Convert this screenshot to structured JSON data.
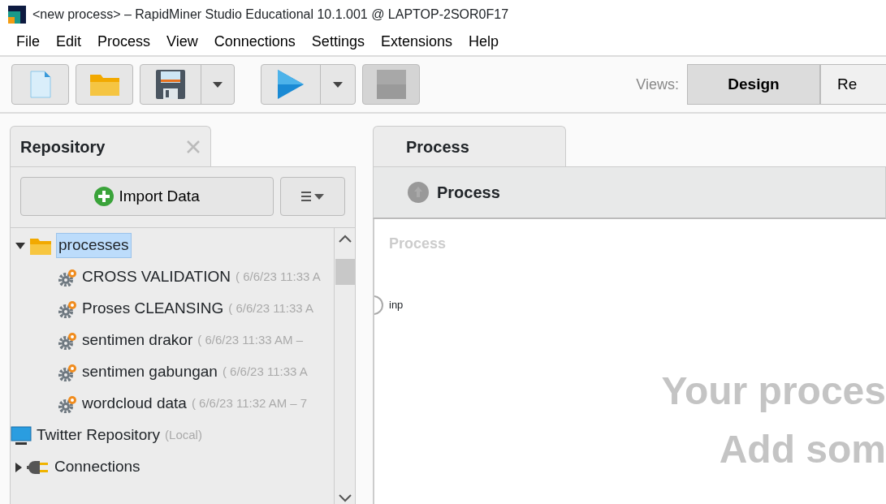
{
  "window": {
    "title": "<new process> – RapidMiner Studio Educational 10.1.001 @ LAPTOP-2SOR0F17"
  },
  "menu": [
    "File",
    "Edit",
    "Process",
    "View",
    "Connections",
    "Settings",
    "Extensions",
    "Help"
  ],
  "toolbar": {
    "views_label": "Views:",
    "views": [
      {
        "label": "Design",
        "selected": true
      },
      {
        "label": "Re",
        "selected": false
      }
    ]
  },
  "repository": {
    "tab": "Repository",
    "import_button": "Import Data",
    "tree": [
      {
        "kind": "folder",
        "label": "processes",
        "expanded": true,
        "selected": true,
        "children": [
          {
            "kind": "process",
            "label": "CROSS VALIDATION",
            "meta": "( 6/6/23 11:33 A"
          },
          {
            "kind": "process",
            "label": "Proses CLEANSING",
            "meta": "( 6/6/23 11:33 A"
          },
          {
            "kind": "process",
            "label": "sentimen drakor",
            "meta": "( 6/6/23 11:33 AM –"
          },
          {
            "kind": "process",
            "label": "sentimen gabungan",
            "meta": "( 6/6/23 11:33 A"
          },
          {
            "kind": "process",
            "label": "wordcloud data",
            "meta": "( 6/6/23 11:32 AM – 7"
          }
        ]
      },
      {
        "kind": "repo",
        "label": "Twitter Repository",
        "meta": "(Local)"
      },
      {
        "kind": "connections",
        "label": "Connections",
        "expanded": false
      }
    ]
  },
  "process": {
    "tab": "Process",
    "breadcrumb": "Process",
    "canvas_title": "Process",
    "port": "inp",
    "hint_lines": [
      "Your proces",
      "Add som"
    ]
  }
}
